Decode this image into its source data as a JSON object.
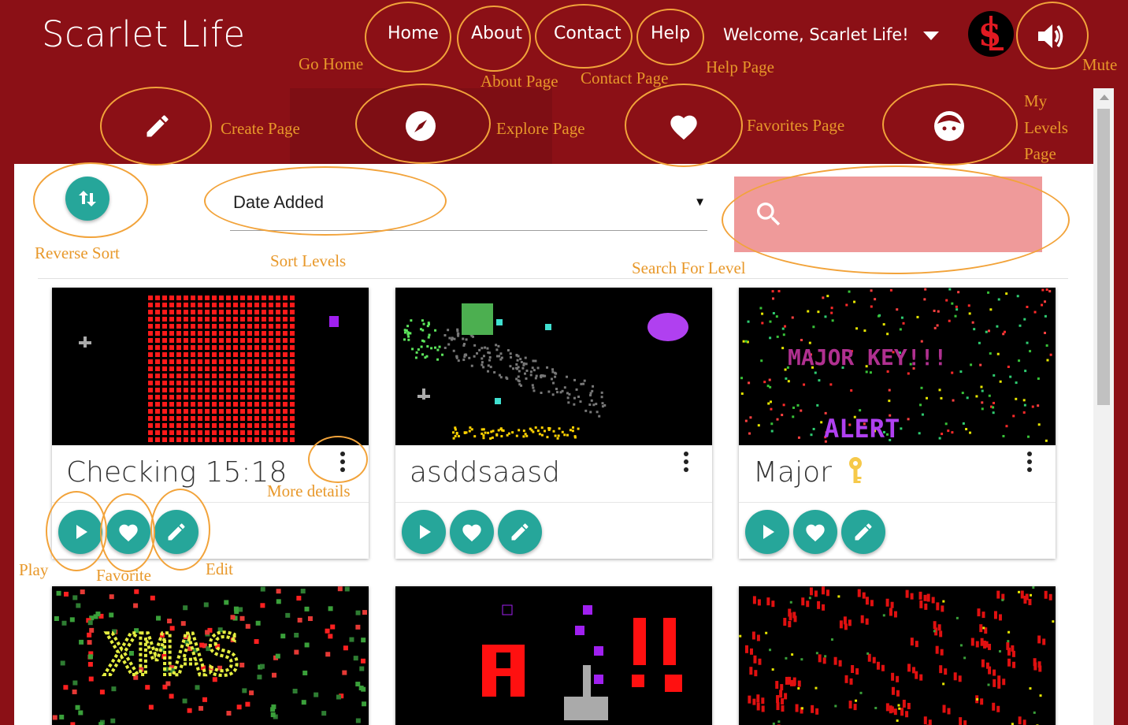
{
  "app": {
    "brand": "Scarlet Life"
  },
  "nav": {
    "home": "Home",
    "about": "About",
    "contact": "Contact",
    "help": "Help",
    "welcome": "Welcome, Scarlet Life!"
  },
  "annotations": {
    "go_home": "Go Home",
    "about_page": "About Page",
    "contact_page": "Contact Page",
    "help_page": "Help Page",
    "mute": "Mute",
    "create_page": "Create Page",
    "explore_page": "Explore Page",
    "favorites_page": "Favorites Page",
    "my_levels_1": "My",
    "my_levels_2": "Levels",
    "my_levels_3": "Page",
    "reverse_sort": "Reverse Sort",
    "sort_levels": "Sort Levels",
    "search_for_level": "Search For Level",
    "more_details": "More details",
    "play": "Play",
    "favorite": "Favorite",
    "edit": "Edit"
  },
  "tabs": [
    {
      "name": "create",
      "icon": "pencil-icon"
    },
    {
      "name": "explore",
      "icon": "compass-icon"
    },
    {
      "name": "favorites",
      "icon": "heart-icon"
    },
    {
      "name": "my-levels",
      "icon": "face-icon"
    }
  ],
  "controls": {
    "sort_value": "Date Added",
    "sort_arrow": "▼",
    "search_placeholder": ""
  },
  "levels": [
    {
      "title": "Checking 15:18"
    },
    {
      "title": "asddsaasd"
    },
    {
      "title": "Major"
    },
    {
      "title": ""
    },
    {
      "title": ""
    },
    {
      "title": ""
    }
  ],
  "colors": {
    "brand_red": "#8b1016",
    "teal": "#26a69a",
    "search_bg": "#ef9a9a",
    "annotation": "#f2a33a"
  }
}
